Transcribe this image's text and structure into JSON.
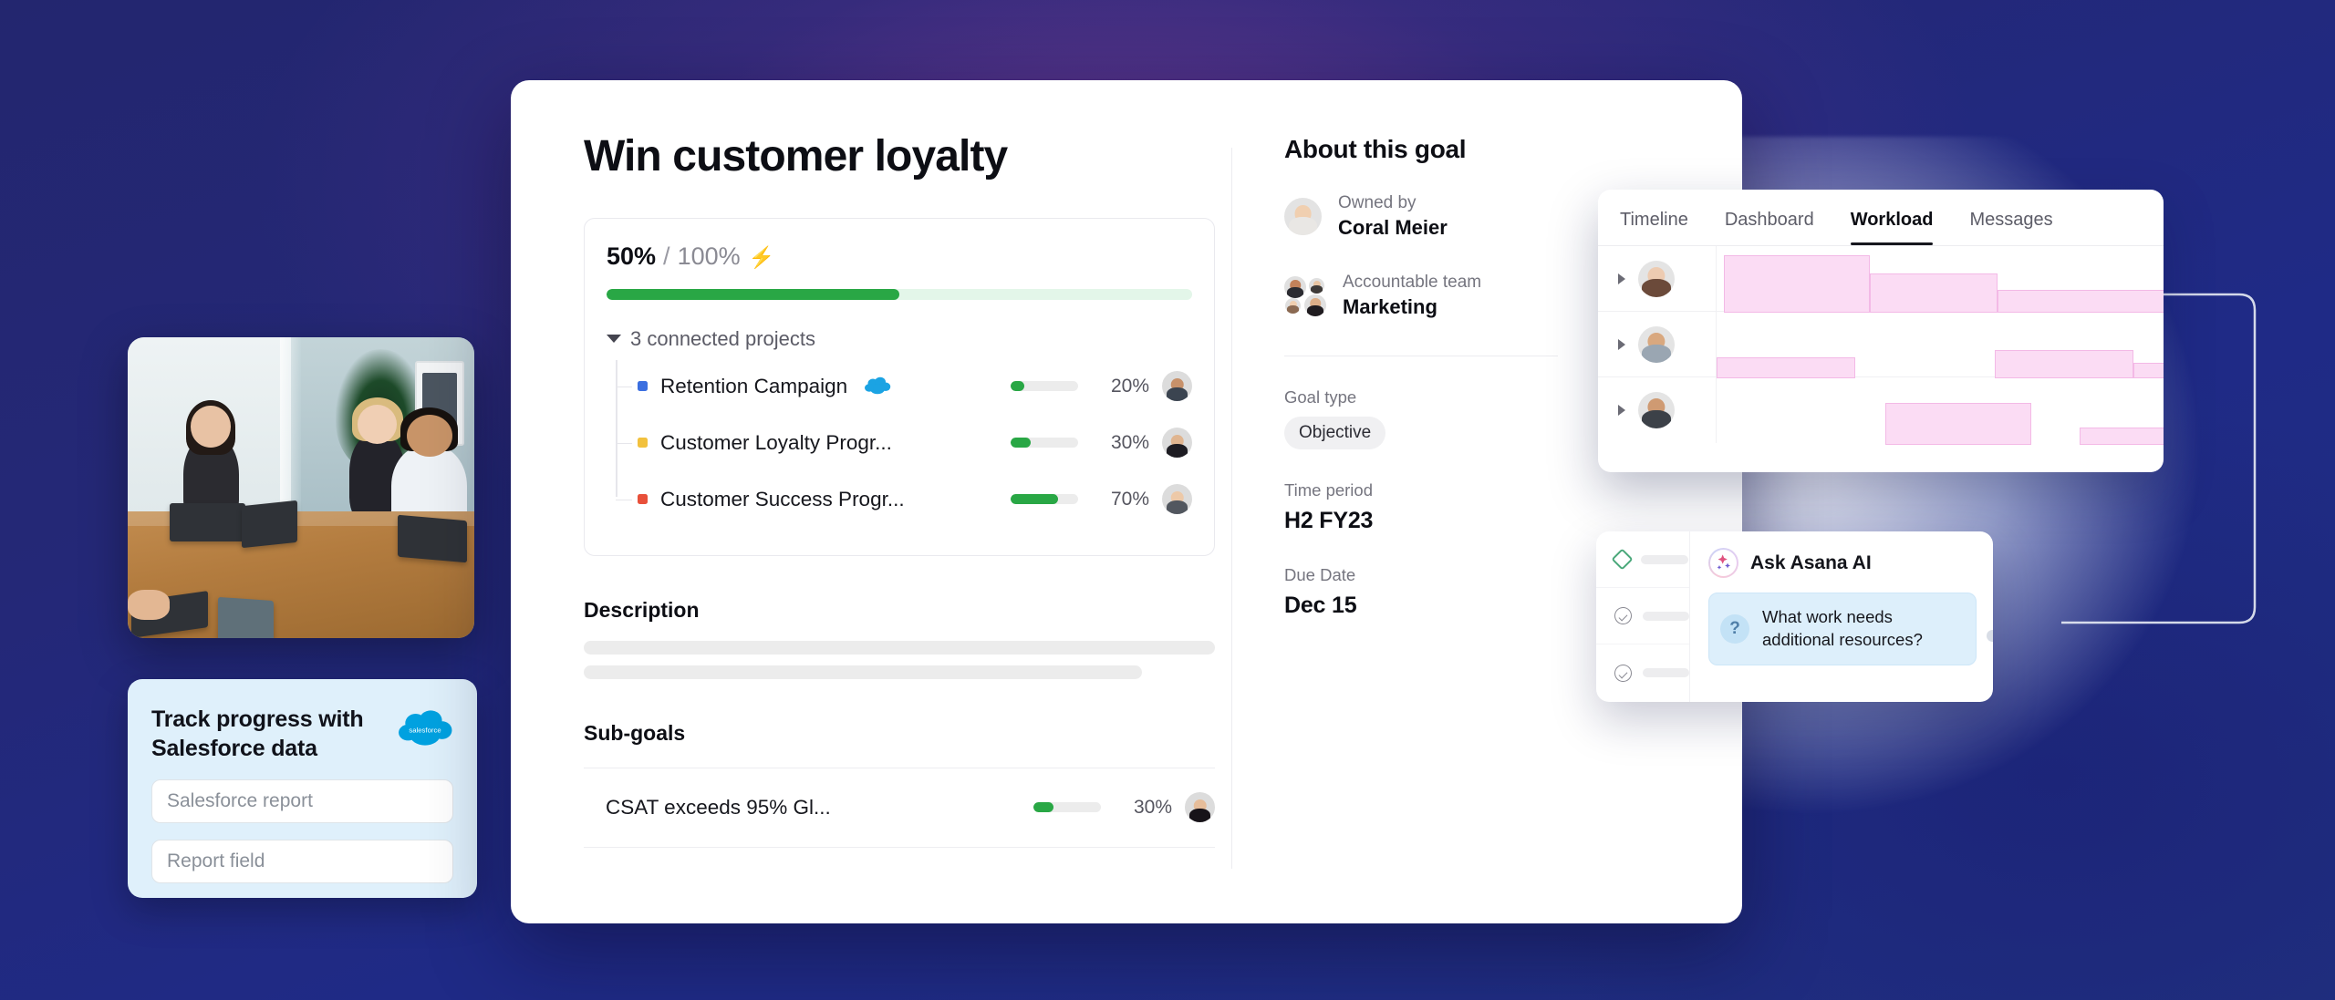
{
  "goal": {
    "title": "Win customer loyalty",
    "progress": {
      "current": "50%",
      "separator": "/",
      "total": "100%",
      "bolt_icon": "⚡",
      "percent_value": 50
    },
    "connected_projects_label": "3 connected projects",
    "projects": [
      {
        "name": "Retention Campaign",
        "color": "#3b6fe0",
        "percent": "20%",
        "percent_value": 20,
        "has_salesforce_icon": true
      },
      {
        "name": "Customer Loyalty Progr...",
        "color": "#f2c13d",
        "percent": "30%",
        "percent_value": 30,
        "has_salesforce_icon": false
      },
      {
        "name": "Customer Success Progr...",
        "color": "#e8503a",
        "percent": "70%",
        "percent_value": 70,
        "has_salesforce_icon": false
      }
    ],
    "description_label": "Description",
    "subgoals_label": "Sub-goals",
    "subgoals": [
      {
        "name": "CSAT exceeds 95% Gl...",
        "percent": "30%",
        "percent_value": 30
      }
    ]
  },
  "about": {
    "heading": "About this goal",
    "owned_by_label": "Owned by",
    "owned_by_value": "Coral Meier",
    "accountable_team_label": "Accountable team",
    "accountable_team_value": "Marketing",
    "goal_type_label": "Goal type",
    "goal_type_value": "Objective",
    "time_period_label": "Time period",
    "time_period_value": "H2 FY23",
    "due_date_label": "Due Date",
    "due_date_value": "Dec 15"
  },
  "workload_panel": {
    "tabs": [
      {
        "label": "Timeline",
        "active": false
      },
      {
        "label": "Dashboard",
        "active": false
      },
      {
        "label": "Workload",
        "active": true
      },
      {
        "label": "Messages",
        "active": false
      }
    ]
  },
  "ai_panel": {
    "title": "Ask Asana AI",
    "question": "What work needs additional resources?",
    "question_badge": "?"
  },
  "salesforce_card": {
    "title": "Track progress with Salesforce data",
    "logo_text": "salesforce",
    "fields": [
      {
        "placeholder": "Salesforce report"
      },
      {
        "placeholder": "Report field"
      }
    ]
  },
  "colors": {
    "background_navy": "#23266f",
    "accent_green": "#29a745",
    "workload_pink": "#fbdcf4",
    "salesforce_blue": "#00a1e0"
  }
}
